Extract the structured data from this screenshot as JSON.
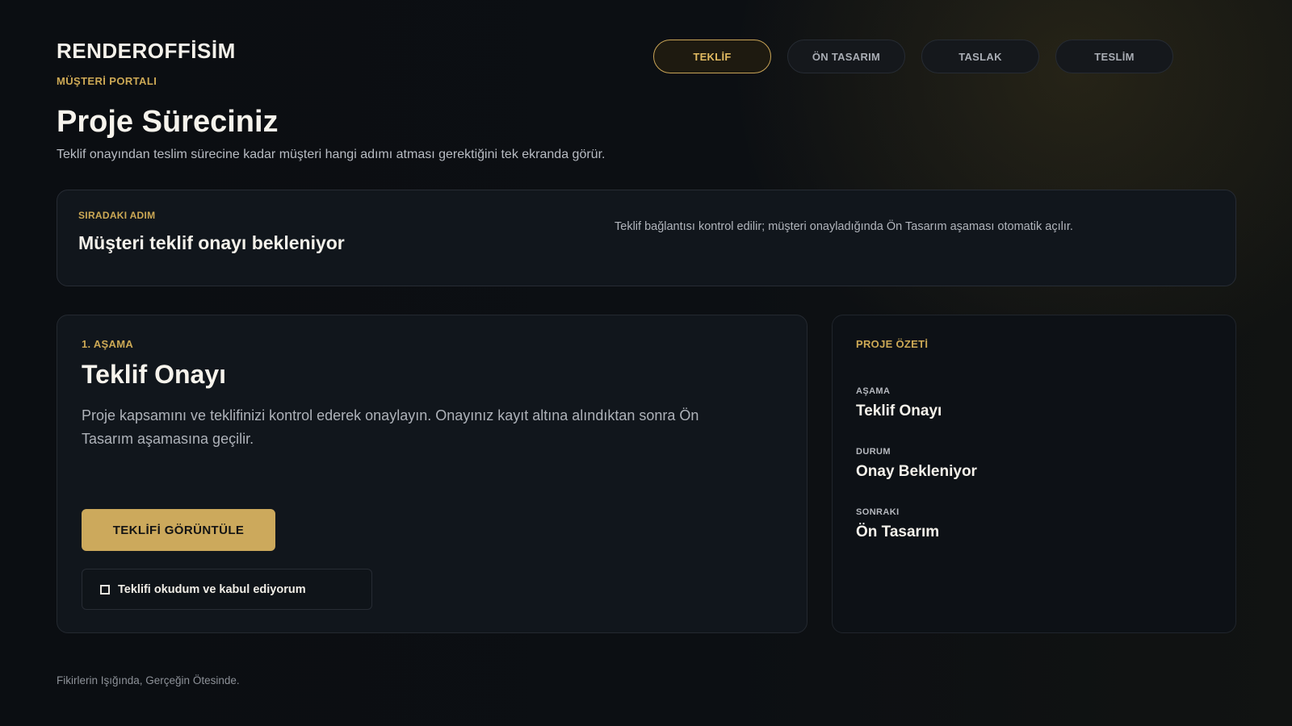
{
  "brand": {
    "name": "RENDEROFFİSİM",
    "subtitle": "MÜŞTERİ PORTALI"
  },
  "steps": [
    {
      "label": "TEKLİF",
      "active": true
    },
    {
      "label": "ÖN TASARIM",
      "active": false
    },
    {
      "label": "TASLAK",
      "active": false
    },
    {
      "label": "TESLİM",
      "active": false
    }
  ],
  "page": {
    "title": "Proje Süreciniz",
    "description": "Teklif onayından teslim sürecine kadar müşteri hangi adımı atması gerektiğini tek ekranda görür."
  },
  "next_step": {
    "label": "SIRADAKI ADIM",
    "title": "Müşteri teklif onayı bekleniyor",
    "note": "Teklif bağlantısı kontrol edilir; müşteri onayladığında Ön Tasarım aşaması otomatik açılır."
  },
  "stage": {
    "label": "1. AŞAMA",
    "title": "Teklif Onayı",
    "description": "Proje kapsamını ve teklifinizi kontrol ederek onaylayın. Onayınız kayıt altına alındıktan sonra Ön Tasarım aşamasına geçilir.",
    "button_label": "TEKLİFİ GÖRÜNTÜLE",
    "accept_label": "Teklifi okudum ve kabul ediyorum",
    "accept_checked": false
  },
  "summary": {
    "label": "PROJE ÖZETİ",
    "items": [
      {
        "key": "AŞAMA",
        "value": "Teklif Onayı"
      },
      {
        "key": "DURUM",
        "value": "Onay Bekleniyor"
      },
      {
        "key": "SONRAKI",
        "value": "Ön Tasarım"
      }
    ]
  },
  "footer": {
    "tagline": "Fikirlerin Işığında, Gerçeğin Ötesinde."
  },
  "colors": {
    "accent": "#cda955",
    "background": "#0b0e12",
    "card": "#11161c"
  }
}
